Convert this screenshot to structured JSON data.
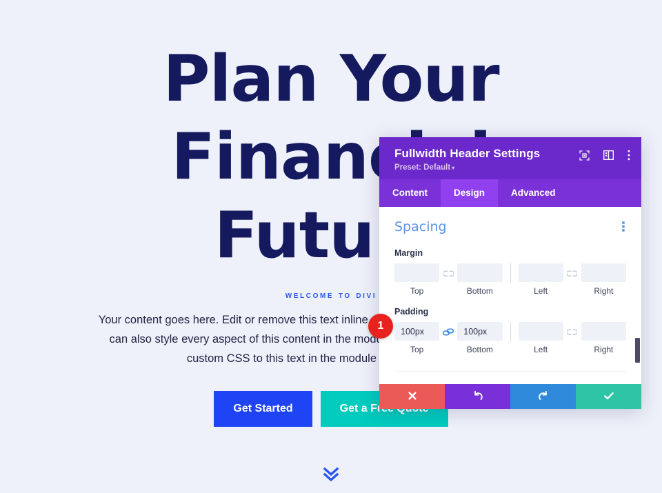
{
  "hero": {
    "title": "Plan Your Financial Future",
    "eyebrow": "Welcome to Divi",
    "body": "Your content goes here. Edit or remove this text inline or in the module Content settings. You can also style every aspect of this content in the module Design settings and even apply custom CSS to this text in the module Advanced settings.",
    "primary_button": "Get Started",
    "secondary_button": "Get a Free Quote",
    "scroll_icon": "double-chevron-down-icon",
    "colors": {
      "background": "#eef1fa",
      "title": "#151a5e",
      "eyebrow": "#2b57f0",
      "primary_button": "#1f44f5",
      "secondary_button": "#00cbbd"
    }
  },
  "panel": {
    "title": "Fullwidth Header Settings",
    "preset_label": "Preset: Default",
    "preset_caret": "▾",
    "header_icons": [
      {
        "name": "focus-target-icon"
      },
      {
        "name": "layout-panel-icon"
      },
      {
        "name": "vertical-dots-menu-icon"
      }
    ],
    "tabs": [
      {
        "label": "Content",
        "active": false
      },
      {
        "label": "Design",
        "active": true
      },
      {
        "label": "Advanced",
        "active": false
      }
    ],
    "section": {
      "title": "Spacing",
      "options_icon": "vertical-dots-menu-icon",
      "groups": [
        {
          "label": "Margin",
          "link_left": {
            "icon": "chain-unlinked-icon",
            "linked": false
          },
          "link_right": {
            "icon": "chain-unlinked-icon",
            "linked": false
          },
          "fields": [
            {
              "caption": "Top",
              "value": "",
              "placeholder": ""
            },
            {
              "caption": "Bottom",
              "value": "",
              "placeholder": ""
            },
            {
              "caption": "Left",
              "value": "",
              "placeholder": ""
            },
            {
              "caption": "Right",
              "value": "",
              "placeholder": ""
            }
          ]
        },
        {
          "label": "Padding",
          "link_left": {
            "icon": "chain-linked-icon",
            "linked": true
          },
          "link_right": {
            "icon": "chain-unlinked-icon",
            "linked": false
          },
          "fields": [
            {
              "caption": "Top",
              "value": "100px",
              "placeholder": ""
            },
            {
              "caption": "Bottom",
              "value": "100px",
              "placeholder": ""
            },
            {
              "caption": "Left",
              "value": "",
              "placeholder": ""
            },
            {
              "caption": "Right",
              "value": "",
              "placeholder": ""
            }
          ]
        }
      ]
    },
    "footer_buttons": [
      {
        "name": "cancel-button",
        "icon": "close-x-icon",
        "color": "#eb5a56"
      },
      {
        "name": "undo-button",
        "icon": "undo-arrow-icon",
        "color": "#7a30d9"
      },
      {
        "name": "redo-button",
        "icon": "redo-arrow-icon",
        "color": "#2f8adb"
      },
      {
        "name": "save-button",
        "icon": "checkmark-icon",
        "color": "#2ec4a5"
      }
    ],
    "colors": {
      "header": "#6b28ca",
      "tabbar": "#7b31d8",
      "tab_active": "#9040ee",
      "section_title": "#5b93e8",
      "input_bg": "#eef1f8",
      "link_active": "#3a8ae0"
    }
  },
  "marker": {
    "number": "1",
    "color": "#e8221f"
  }
}
